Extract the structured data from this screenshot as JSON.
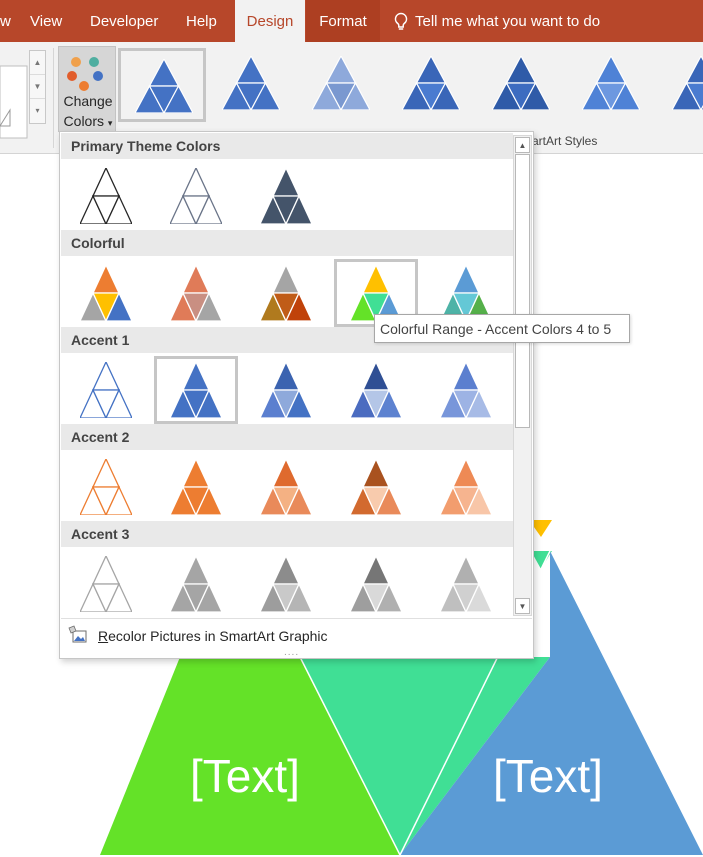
{
  "tabs": [
    {
      "label": "w",
      "state": "normal"
    },
    {
      "label": "View",
      "state": "normal"
    },
    {
      "label": "Developer",
      "state": "normal"
    },
    {
      "label": "Help",
      "state": "normal"
    },
    {
      "label": "Design",
      "state": "active"
    },
    {
      "label": "Format",
      "state": "contextual"
    }
  ],
  "tell_me": {
    "label": "Tell me what you want to do",
    "icon": "lightbulb-icon"
  },
  "ribbon": {
    "change_colors": {
      "line1": "Change",
      "line2": "Colors",
      "dropdown_glyph": "▾",
      "icon": "color-palette-icon",
      "dot_colors": [
        "#f0a04b",
        "#4faea0",
        "#4472c4",
        "#e15d2c",
        "#ed7d31",
        "#5a6fd6"
      ]
    },
    "layout_scroll": {
      "up": "▲",
      "down": "▼",
      "more": "▾"
    },
    "styles_caption": "artArt Styles",
    "style_count": 7
  },
  "dropdown": {
    "sections": [
      {
        "title": "Primary Theme Colors"
      },
      {
        "title": "Colorful"
      },
      {
        "title": "Accent 1"
      },
      {
        "title": "Accent 2"
      },
      {
        "title": "Accent 3"
      }
    ],
    "selected_colorful_index": 3,
    "selected_accent1_index": 1,
    "recolor_label": "Recolor Pictures in SmartArt Graphic",
    "recolor_icon": "recolor-pictures-icon",
    "grip": "....",
    "scroll_up": "▲",
    "scroll_down": "▼"
  },
  "tooltip": "Colorful Range - Accent Colors 4 to 5",
  "slide": {
    "text_left": "[Text]",
    "text_right": "[Text]"
  },
  "colors": {
    "tab_bar": "#b7472a",
    "accent1": "#4472c4",
    "colorful_green": "#64e228",
    "colorful_teal": "#40df95",
    "colorful_blue": "#5b9bd5",
    "colorful_yellow": "#ffc000"
  }
}
